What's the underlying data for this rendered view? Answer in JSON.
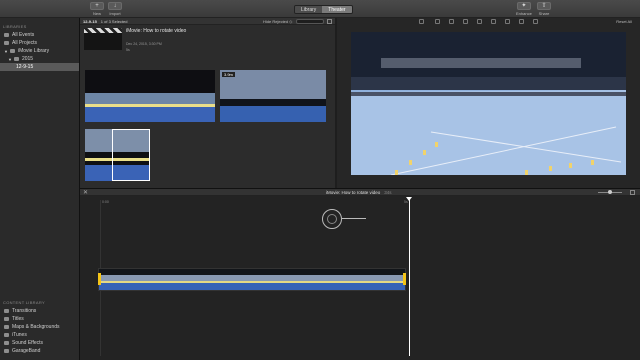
{
  "toolbar": {
    "left_buttons": [
      {
        "icon": "plus-icon",
        "label": "New"
      },
      {
        "icon": "import-icon",
        "label": "Import"
      }
    ],
    "segments": [
      {
        "label": "Library",
        "active": false
      },
      {
        "label": "Theater",
        "active": true
      }
    ],
    "right_buttons": [
      {
        "icon": "enhance-icon",
        "label": "Enhance"
      },
      {
        "icon": "share-icon",
        "label": "Share"
      }
    ]
  },
  "sidebar": {
    "libraries_header": "LIBRARIES",
    "items": [
      {
        "label": "All Events",
        "selected": false
      },
      {
        "label": "All Projects",
        "selected": false
      },
      {
        "label": "iMovie Library",
        "selected": false
      },
      {
        "label": "2015",
        "selected": false
      },
      {
        "label": "12-9-15",
        "selected": true
      }
    ],
    "content_library_header": "CONTENT LIBRARY",
    "content_items": [
      {
        "label": "Transitions"
      },
      {
        "label": "Titles"
      },
      {
        "label": "Maps & Backgrounds"
      },
      {
        "label": "iTunes"
      },
      {
        "label": "Sound Effects"
      },
      {
        "label": "GarageBand"
      }
    ]
  },
  "browser": {
    "event_name": "12-9-15",
    "selection_count": "1 of 3 Selected",
    "hide_rejected": "Hide Rejected ◇",
    "project": {
      "title": "iMovie: How to rotate video",
      "date": "Dec 24, 2015, 3:30 PM",
      "duration": "5s"
    },
    "clip_badge": "3.9m"
  },
  "viewer": {
    "reset_all": "Reset All"
  },
  "timeline": {
    "project_title": "iMovie: How to rotate video",
    "duration": "34s",
    "ruler_start": "0:00",
    "ruler_mark": "5s"
  },
  "colors": {
    "accent_yellow": "#f5c518",
    "selection_white": "#ffffff",
    "chrome_dark": "#1e1e1e"
  }
}
